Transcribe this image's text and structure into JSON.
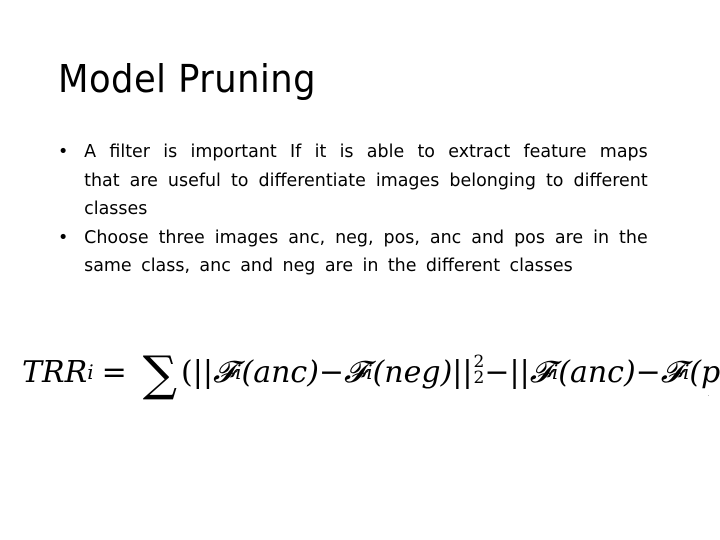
{
  "slide": {
    "title": "Model  Pruning",
    "bullets": [
      {
        "marker": "•",
        "text": "A  filter  is  important  If  it  is  able  to  extract  feature  maps  that  are  useful  to  differentiate  images  belonging  to  different  classes"
      },
      {
        "marker": "•",
        "text": "Choose  three  images   anc,  neg,  pos,  anc  and  pos  are  in  the  same  class,  anc  and  neg  are  in  the  different  classes"
      }
    ],
    "formula": {
      "lhs": "TRR",
      "lhs_sub": "i",
      "equals": "=",
      "sum": "∑",
      "open_paren": "(",
      "norm": "||",
      "F": "𝓕",
      "F_sub": "i",
      "anc": "(anc)",
      "minus": "−",
      "neg": "(neg)",
      "pos": "(pos)",
      "sup": "2",
      "sub": "2",
      "close_paren": ")"
    }
  }
}
